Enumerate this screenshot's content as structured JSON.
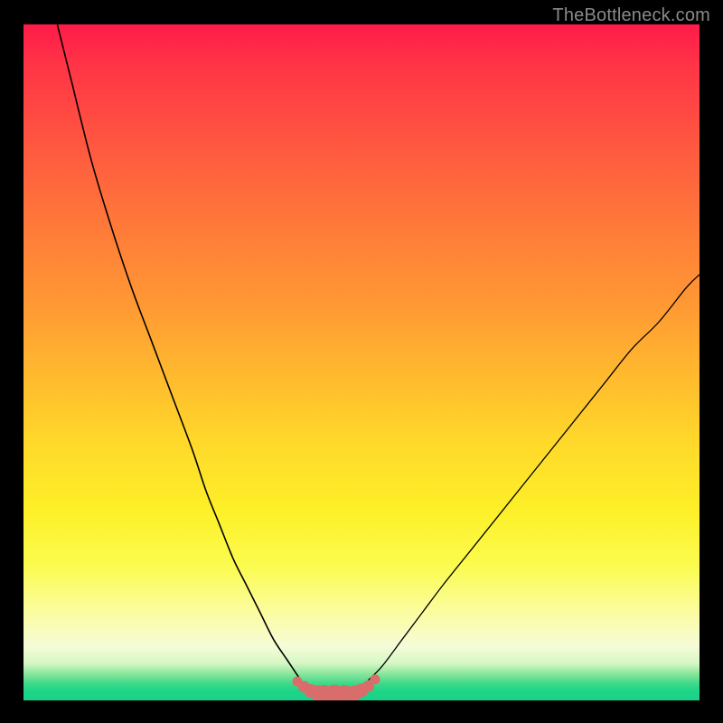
{
  "watermark": "TheBottleneck.com",
  "chart_data": {
    "type": "line",
    "title": "",
    "xlabel": "",
    "ylabel": "",
    "xlim": [
      0,
      100
    ],
    "ylim": [
      0,
      100
    ],
    "grid": false,
    "legend": false,
    "series": [
      {
        "name": "curve-left",
        "color": "#000000",
        "x": [
          5,
          7,
          10,
          13,
          16,
          19,
          22,
          25,
          27,
          29,
          31,
          33,
          35,
          37,
          39,
          41
        ],
        "y": [
          100,
          92,
          80,
          70,
          61,
          53,
          45,
          37,
          31,
          26,
          21,
          17,
          13,
          9,
          6,
          3
        ]
      },
      {
        "name": "curve-right",
        "color": "#000000",
        "x": [
          51,
          53,
          56,
          59,
          62,
          66,
          70,
          74,
          78,
          82,
          86,
          90,
          94,
          98,
          100
        ],
        "y": [
          3,
          5,
          9,
          13,
          17,
          22,
          27,
          32,
          37,
          42,
          47,
          52,
          56,
          61,
          63
        ]
      },
      {
        "name": "valley-markers",
        "color": "#d96d6b",
        "type": "scatter",
        "x": [
          40.5,
          41.5,
          42.5,
          43.5,
          44.5,
          46.0,
          47.5,
          49.0,
          50.0,
          51.0,
          52.0
        ],
        "y": [
          2.8,
          2.0,
          1.4,
          1.1,
          1.0,
          1.0,
          1.0,
          1.1,
          1.5,
          2.1,
          3.1
        ]
      }
    ],
    "gradient_stops": [
      {
        "pos": 0,
        "color": "#ff1b49"
      },
      {
        "pos": 0.3,
        "color": "#ff7a39"
      },
      {
        "pos": 0.62,
        "color": "#ffd92a"
      },
      {
        "pos": 0.88,
        "color": "#fbfca0"
      },
      {
        "pos": 1.0,
        "color": "#17d289"
      }
    ]
  }
}
